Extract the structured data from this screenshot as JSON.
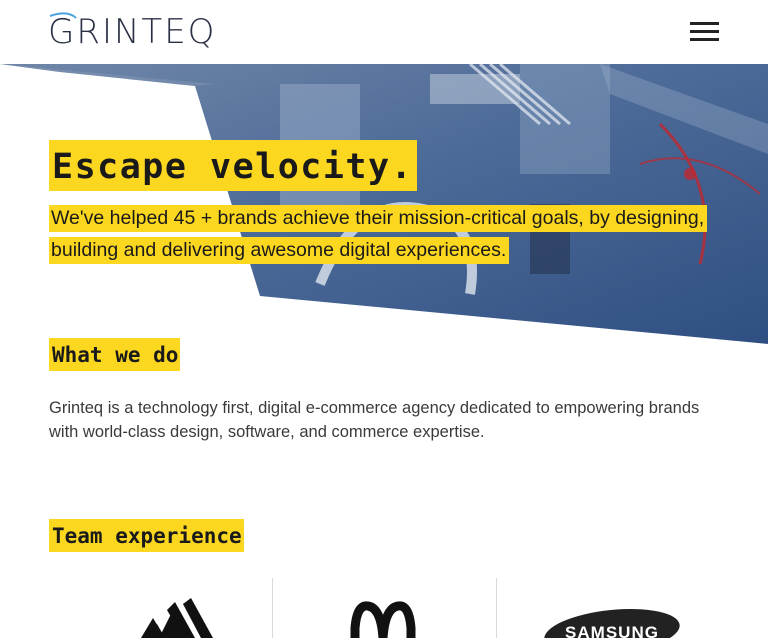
{
  "header": {
    "logo_text": "GRINTEQ",
    "menu_icon": "hamburger-menu-icon"
  },
  "hero": {
    "title": "Escape velocity.",
    "subtitle": "We've helped 45 + brands achieve their mission-critical goals, by designing, building and delivering awesome digital experiences."
  },
  "what_we_do": {
    "heading": "What we do",
    "text": "Grinteq is a technology first, digital e-commerce agency dedicated to empowering brands with world-class design, software, and commerce expertise."
  },
  "team_experience": {
    "heading": "Team experience",
    "logos": [
      {
        "name": "adidas",
        "icon": "adidas-logo-icon"
      },
      {
        "name": "McDonald's",
        "icon": "mcdonalds-logo-icon"
      },
      {
        "name": "SAMSUNG",
        "icon": "samsung-logo-icon"
      }
    ]
  },
  "colors": {
    "accent": "#fcd71f",
    "hero_tint": "#3b5c8f",
    "text": "#333333"
  }
}
